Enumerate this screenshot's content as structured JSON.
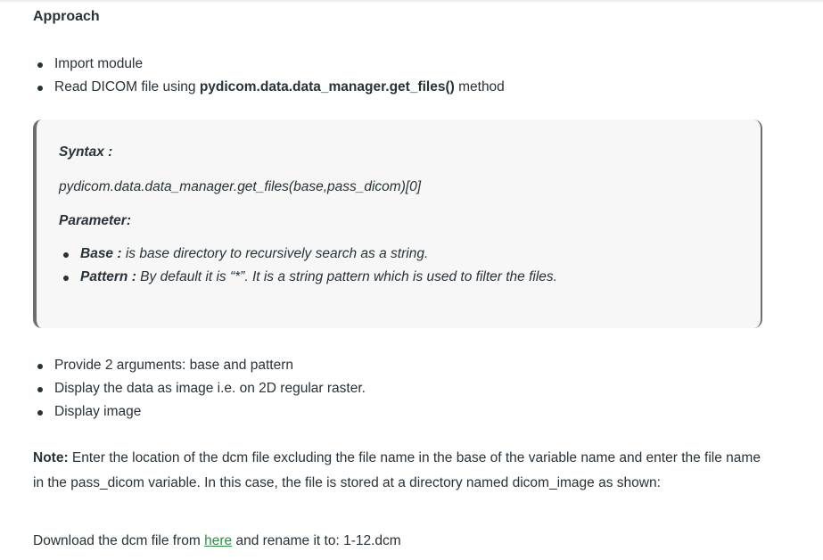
{
  "article": {
    "heading": "Approach",
    "steps_1": [
      {
        "text": "Import module"
      },
      {
        "prefix": "Read DICOM file using ",
        "bold": "pydicom.data.data_manager.get_files()",
        "suffix": " method"
      }
    ],
    "syntax_box": {
      "syntax_label": "Syntax :",
      "syntax_code": "pydicom.data.data_manager.get_files(base,pass_dicom)[0]",
      "parameter_label": "Parameter:",
      "parameters": [
        {
          "name": "Base :",
          "desc": " is base directory to recursively search as a string."
        },
        {
          "name": "Pattern :",
          "desc": " By default it is “*”. It is a string pattern which is used to filter the files."
        }
      ]
    },
    "steps_2": [
      "Provide 2 arguments: base and pattern",
      "Display the data as image i.e. on 2D regular raster.",
      "Display image"
    ],
    "note": {
      "label": "Note:",
      "text": " Enter the location of the dcm file excluding the file name in the base of the variable name and enter the file name in the pass_dicom variable. In this case, the file is stored at a directory named dicom_image as shown:"
    },
    "download": {
      "prefix": "Download the dcm file from ",
      "link_text": "here",
      "suffix": " and rename it to: 1-12.dcm"
    }
  },
  "colors": {
    "text": "#273239",
    "link": "#2f8d46",
    "box_background": "#f7f7f7",
    "box_border": "#6e6e6e"
  }
}
